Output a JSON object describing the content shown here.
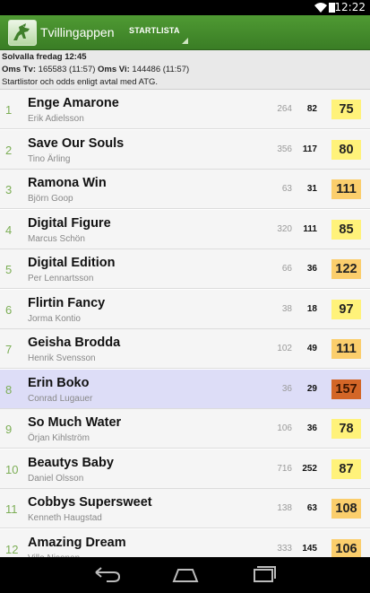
{
  "status_bar": {
    "time": "12:22",
    "icons": [
      "wifi-icon",
      "battery-icon"
    ]
  },
  "action_bar": {
    "app_title": "Tvillingappen",
    "tab_label": "STARTLISTA",
    "colors": {
      "bar": "#3f8529"
    }
  },
  "header": {
    "race_title": "Solvalla fredag 12:45",
    "oms_tv_label": "Oms Tv:",
    "oms_tv_value": "165583 (11:57)",
    "oms_vi_label": "Oms Vi:",
    "oms_vi_value": "144486 (11:57)",
    "note": "Startlistor och odds enligt avtal med ATG."
  },
  "rows": [
    {
      "num": "1",
      "horse": "Enge Amarone",
      "driver": "Erik Adielsson",
      "oms": "264",
      "odds": "82",
      "score": "75",
      "score_class": "s-y"
    },
    {
      "num": "2",
      "horse": "Save Our Souls",
      "driver": "Tino Ärling",
      "oms": "356",
      "odds": "117",
      "score": "80",
      "score_class": "s-y"
    },
    {
      "num": "3",
      "horse": "Ramona Win",
      "driver": "Björn Goop",
      "oms": "63",
      "odds": "31",
      "score": "111",
      "score_class": "s-o"
    },
    {
      "num": "4",
      "horse": "Digital Figure",
      "driver": "Marcus Schön",
      "oms": "320",
      "odds": "111",
      "score": "85",
      "score_class": "s-y"
    },
    {
      "num": "5",
      "horse": "Digital Edition",
      "driver": "Per Lennartsson",
      "oms": "66",
      "odds": "36",
      "score": "122",
      "score_class": "s-o"
    },
    {
      "num": "6",
      "horse": "Flirtin Fancy",
      "driver": "Jorma Kontio",
      "oms": "38",
      "odds": "18",
      "score": "97",
      "score_class": "s-y"
    },
    {
      "num": "7",
      "horse": "Geisha Brodda",
      "driver": "Henrik Svensson",
      "oms": "102",
      "odds": "49",
      "score": "111",
      "score_class": "s-o"
    },
    {
      "num": "8",
      "horse": "Erin Boko",
      "driver": "Conrad Lugauer",
      "oms": "36",
      "odds": "29",
      "score": "157",
      "score_class": "s-d",
      "selected": true
    },
    {
      "num": "9",
      "horse": "So Much Water",
      "driver": "Örjan Kihlström",
      "oms": "106",
      "odds": "36",
      "score": "78",
      "score_class": "s-y"
    },
    {
      "num": "10",
      "horse": "Beautys Baby",
      "driver": "Daniel Olsson",
      "oms": "716",
      "odds": "252",
      "score": "87",
      "score_class": "s-y"
    },
    {
      "num": "11",
      "horse": "Cobbys Supersweet",
      "driver": "Kenneth Haugstad",
      "oms": "138",
      "odds": "63",
      "score": "108",
      "score_class": "s-o"
    },
    {
      "num": "12",
      "horse": "Amazing Dream",
      "driver": "Ville Nisonen",
      "oms": "333",
      "odds": "145",
      "score": "106",
      "score_class": "s-o"
    }
  ],
  "nav_bar": {
    "buttons": [
      "back-icon",
      "home-icon",
      "recent-apps-icon"
    ]
  }
}
